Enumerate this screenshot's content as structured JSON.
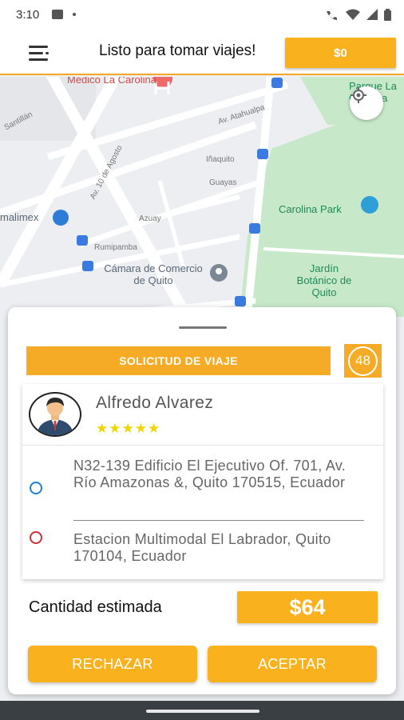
{
  "status_bar": {
    "time": "3:10",
    "icons": [
      "image-icon",
      "dot-icon",
      "wifi-calling-icon",
      "wifi-icon",
      "signal-icon",
      "battery-icon"
    ]
  },
  "app_bar": {
    "menu_icon": "menu-icon",
    "title": "Listo para tomar viajes!",
    "balance": "$0"
  },
  "map": {
    "labels": {
      "hospital": "Médico La Carolina",
      "park_top": "Parque La Carolina",
      "atahualpa": "Av. Atahualpa",
      "santillan": "Santillán",
      "agosto": "Av. 10 de Agosto",
      "inaquito": "Iñaquito",
      "guayas": "Guayas",
      "carolina_park": "Carolina Park",
      "alimex": "malimex",
      "azuay": "Azuay",
      "rumipamba": "Rumipamba",
      "camara": "Cámara de Comercio de Quito",
      "jardin": "Jardín Botánico de Quito"
    },
    "locate_icon": "my-location-icon"
  },
  "request": {
    "title": "SOLICITUD DE VIAJE",
    "timer": "48"
  },
  "passenger": {
    "name": "Alfredo Alvarez",
    "rating": "★★★★★"
  },
  "trip": {
    "origin": "N32-139 Edificio El Ejecutivo Of. 701, Av. Río Amazonas &, Quito 170515, Ecuador",
    "destination": "Estacion Multimodal El Labrador, Quito 170104, Ecuador"
  },
  "estimate": {
    "label": "Cantidad estimada",
    "value": "$64"
  },
  "actions": {
    "reject": "RECHAZAR",
    "accept": "ACEPTAR"
  },
  "colors": {
    "accent": "#f9b21e",
    "origin_pin": "#1f7dd0",
    "destination_pin": "#c83232",
    "star": "#f2d400"
  }
}
